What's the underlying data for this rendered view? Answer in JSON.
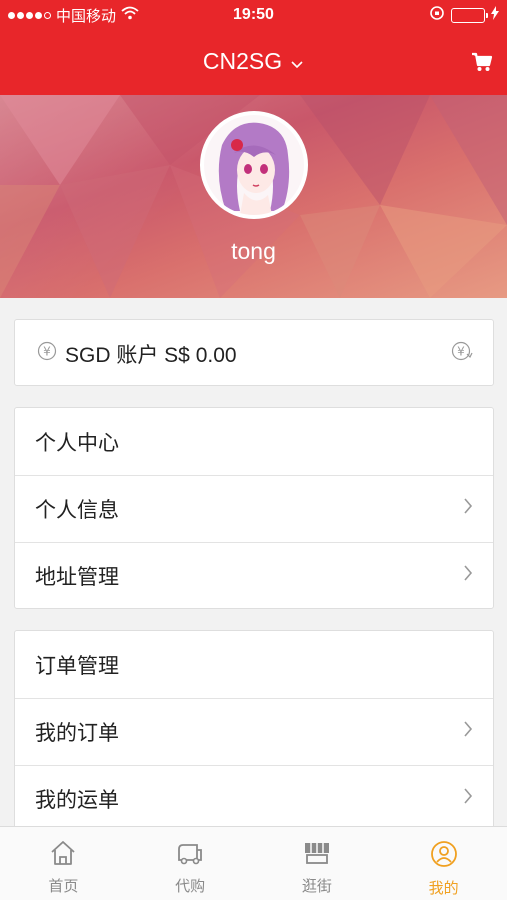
{
  "status_bar": {
    "carrier": "中国移动",
    "time": "19:50"
  },
  "nav": {
    "title": "CN2SG",
    "cart_icon": "cart-icon"
  },
  "profile": {
    "username": "tong"
  },
  "account": {
    "text": "SGD 账户  S$ 0.00"
  },
  "sections": [
    {
      "header": "个人中心",
      "items": [
        "个人信息",
        "地址管理"
      ]
    },
    {
      "header": "订单管理",
      "items": [
        "我的订单",
        "我的运单"
      ]
    }
  ],
  "tabbar": {
    "tabs": [
      {
        "label": "首页",
        "icon": "home-icon"
      },
      {
        "label": "代购",
        "icon": "truck-icon"
      },
      {
        "label": "逛街",
        "icon": "store-icon"
      },
      {
        "label": "我的",
        "icon": "user-icon"
      }
    ],
    "active_index": 3,
    "active_color": "#f0a020"
  },
  "colors": {
    "brand": "#e8262a"
  }
}
